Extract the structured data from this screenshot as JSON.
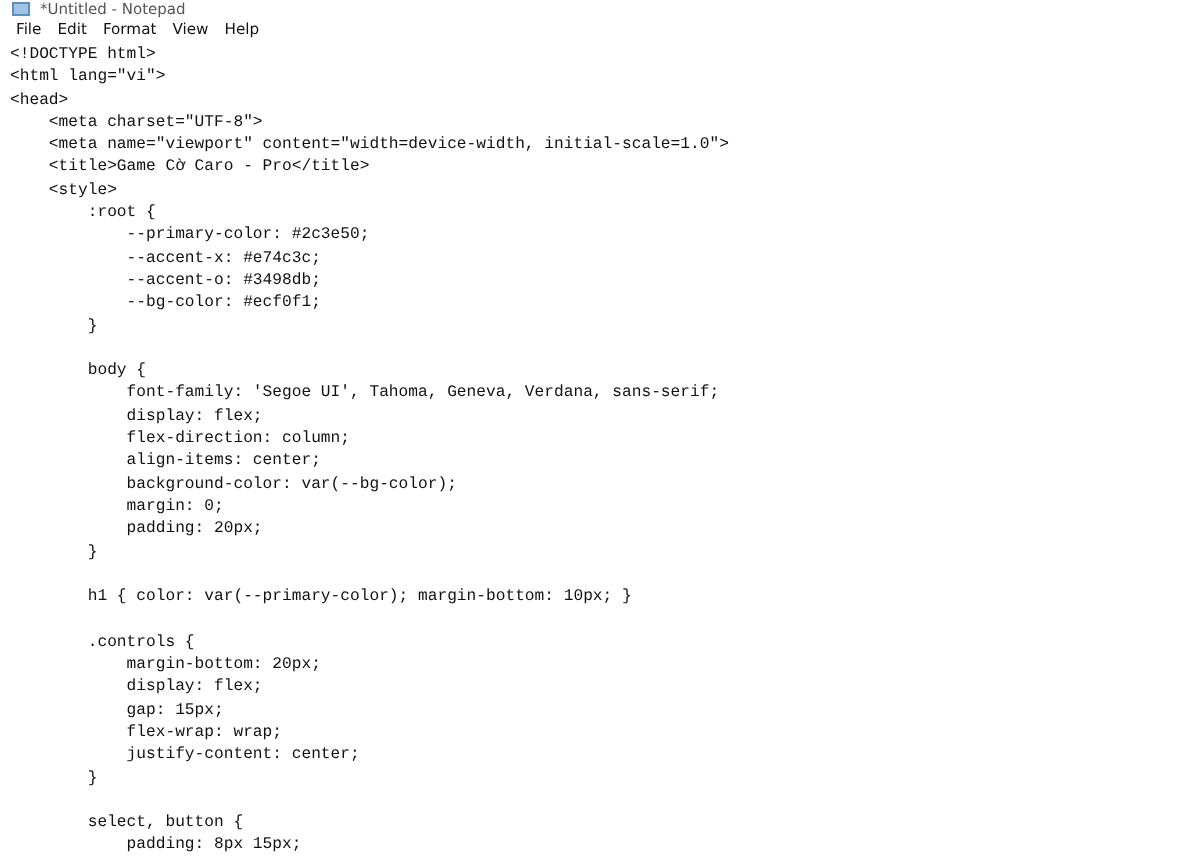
{
  "window": {
    "title": "*Untitled - Notepad"
  },
  "menu": [
    "File",
    "Edit",
    "Format",
    "View",
    "Help"
  ],
  "editor": {
    "blocks": [
      {
        "lines": [
          "<!DOCTYPE html>",
          "<html lang=\"vi\">",
          "<head>",
          "    <meta charset=\"UTF-8\">",
          "    <meta name=\"viewport\" content=\"width=device-width, initial-scale=1.0\">",
          "    <title>Game Cờ Caro - Pro</title>",
          "    <style>",
          "        :root {",
          "            --primary-color: #2c3e50;",
          "            --accent-x: #e74c3c;",
          "            --accent-o: #3498db;",
          "            --bg-color: #ecf0f1;",
          "        }"
        ]
      },
      {
        "lines": [
          "        body {",
          "            font-family: 'Segoe UI', Tahoma, Geneva, Verdana, sans-serif;",
          "            display: flex;",
          "            flex-direction: column;",
          "            align-items: center;",
          "            background-color: var(--bg-color);",
          "            margin: 0;",
          "            padding: 20px;",
          "        }"
        ]
      },
      {
        "lines": [
          "        h1 { color: var(--primary-color); margin-bottom: 10px; }"
        ]
      },
      {
        "lines": [
          "        .controls {",
          "            margin-bottom: 20px;",
          "            display: flex;",
          "            gap: 15px;",
          "            flex-wrap: wrap;",
          "            justify-content: center;",
          "        }"
        ]
      },
      {
        "lines": [
          "        select, button {",
          "            padding: 8px 15px;"
        ]
      }
    ]
  }
}
